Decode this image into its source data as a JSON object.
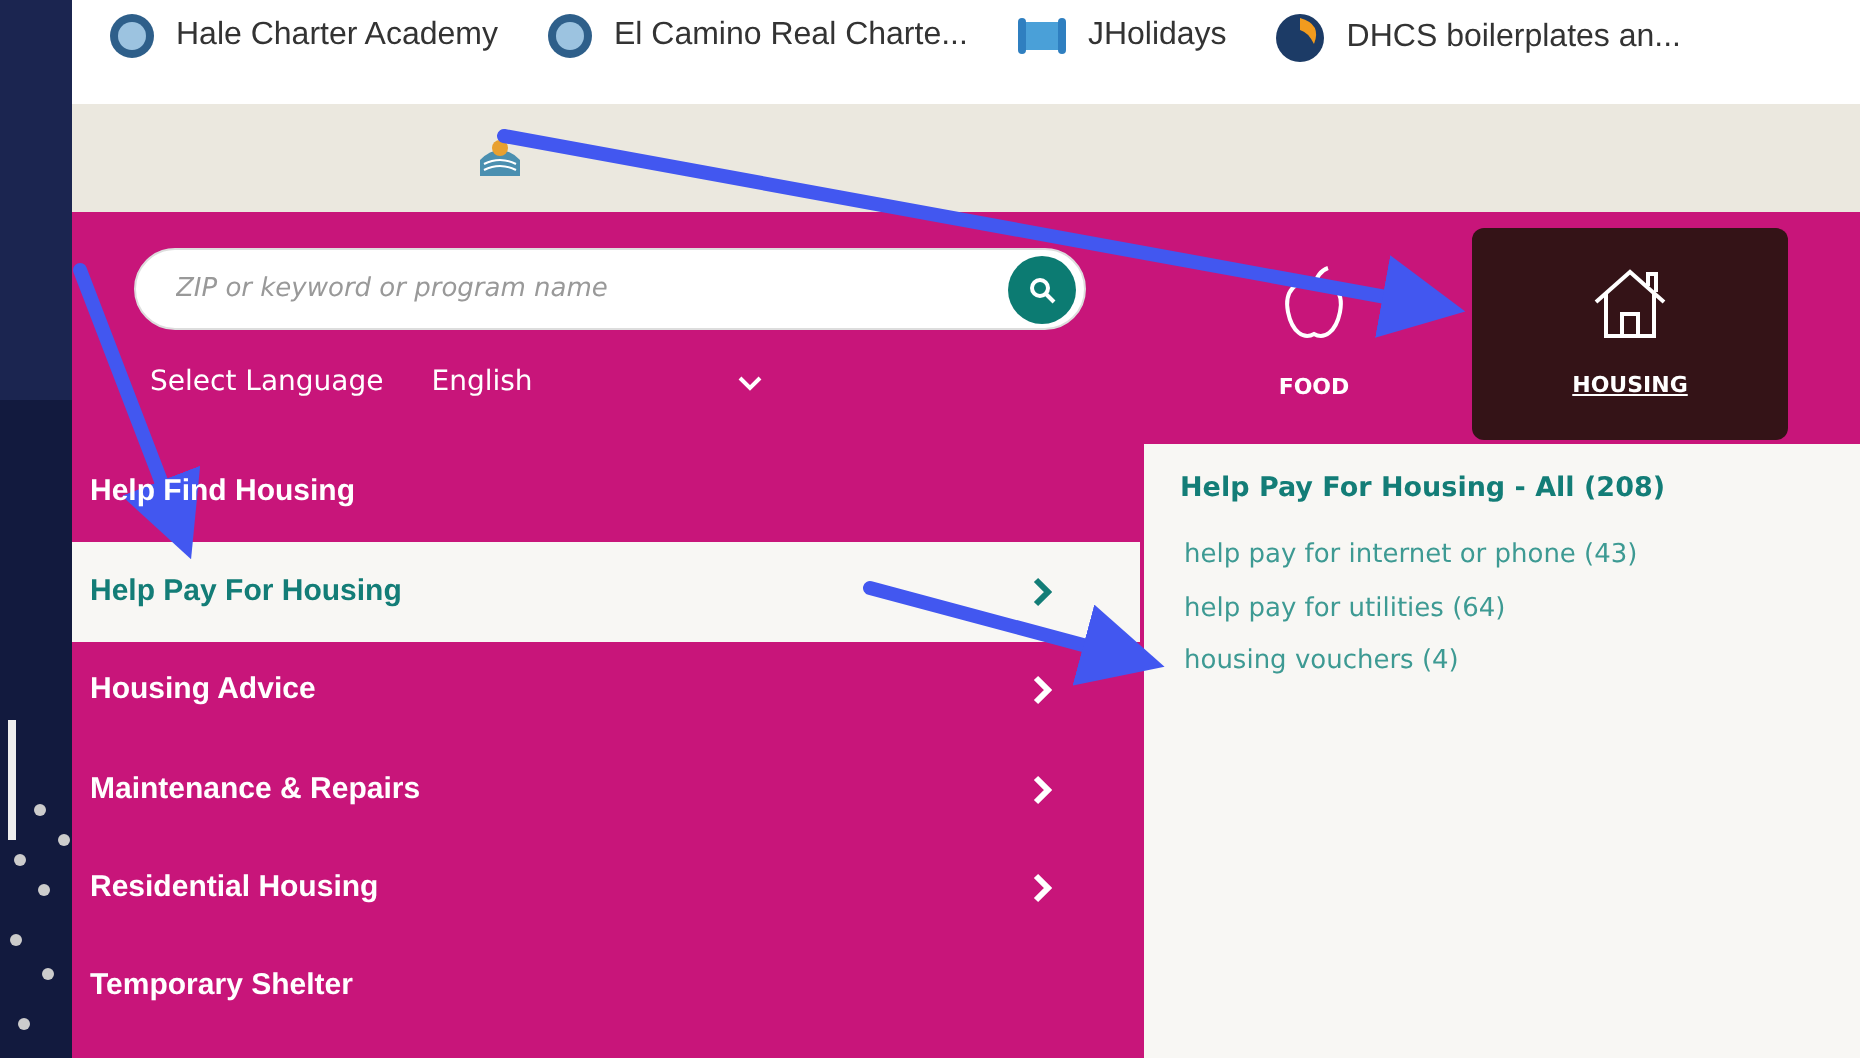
{
  "bookmarks": [
    {
      "label": "Hale Charter Academy",
      "kind": "seal"
    },
    {
      "label": "El Camino Real Charte...",
      "kind": "seal"
    },
    {
      "label": "JHolidays",
      "kind": "scroll"
    },
    {
      "label": "DHCS  boilerplates an...",
      "kind": "circle"
    }
  ],
  "search": {
    "placeholder": "ZIP or keyword or program name"
  },
  "language": {
    "label": "Select Language",
    "value": "English"
  },
  "categories": [
    {
      "label": "FOOD",
      "kind": "apple",
      "selected": false
    },
    {
      "label": "HOUSING",
      "kind": "house",
      "selected": true
    }
  ],
  "menu": [
    {
      "label": "Help Find Housing",
      "selected": false,
      "has_submenu": false
    },
    {
      "label": "Help Pay For Housing",
      "selected": true,
      "has_submenu": true
    },
    {
      "label": "Housing Advice",
      "selected": false,
      "has_submenu": true
    },
    {
      "label": "Maintenance & Repairs",
      "selected": false,
      "has_submenu": true
    },
    {
      "label": "Residential Housing",
      "selected": false,
      "has_submenu": true
    },
    {
      "label": "Temporary Shelter",
      "selected": false,
      "has_submenu": false
    }
  ],
  "submenu": {
    "title": "Help Pay For Housing - All (208)",
    "links": [
      "help pay for internet or phone (43)",
      "help pay for utilities (64)",
      "housing vouchers (4)"
    ]
  }
}
